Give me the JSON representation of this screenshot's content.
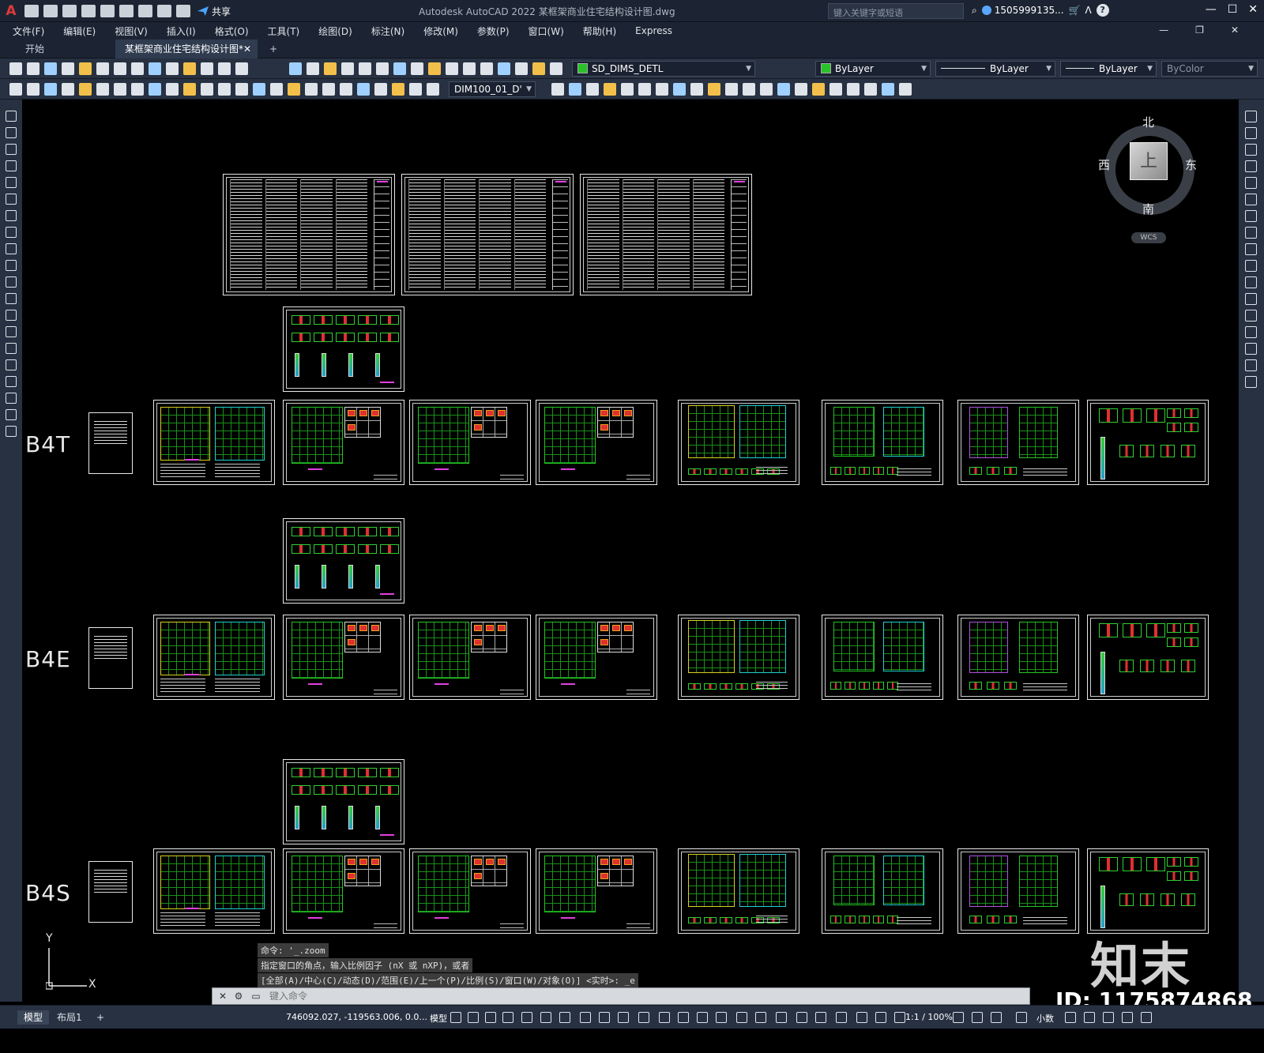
{
  "app": {
    "window_title": "Autodesk AutoCAD 2022    某框架商业住宅结构设计图.dwg",
    "share_label": "共享",
    "search_placeholder": "键入关键字或短语",
    "user": "1505999135...",
    "menus": [
      "文件(F)",
      "编辑(E)",
      "视图(V)",
      "插入(I)",
      "格式(O)",
      "工具(T)",
      "绘图(D)",
      "标注(N)",
      "修改(M)",
      "参数(P)",
      "窗口(W)",
      "帮助(H)",
      "Express"
    ]
  },
  "tabs": {
    "start": "开始",
    "document": "某框架商业住宅结构设计图*"
  },
  "toolbar": {
    "layer": "SD_DIMS_DETL",
    "color": "ByLayer",
    "linetype": "ByLayer",
    "lineweight": "ByLayer",
    "plotstyle": "ByColor",
    "dimstyle": "DIM100_01_D'"
  },
  "viewcube": {
    "north": "北",
    "south": "南",
    "east": "东",
    "west": "西",
    "face": "上",
    "wcs": "WCS"
  },
  "drawing": {
    "rows": [
      "B4T",
      "B4E",
      "B4S"
    ]
  },
  "ucs": {
    "x": "X",
    "y": "Y"
  },
  "command": {
    "history": [
      "命令: '_.zoom",
      "指定窗口的角点，输入比例因子 (nX 或 nXP)，或者",
      "[全部(A)/中心(C)/动态(D)/范围(E)/上一个(P)/比例(S)/窗口(W)/对象(O)] <实时>: _e"
    ],
    "placeholder": "键入命令"
  },
  "status": {
    "model_tab": "模型",
    "layout_tab": "布局1",
    "coords": "746092.027, -119563.006, 0.0...",
    "space": "模型",
    "scale": "1:1 / 100%",
    "units": "小数"
  },
  "watermark": {
    "brand": "知末",
    "id": "ID: 1175874868"
  }
}
